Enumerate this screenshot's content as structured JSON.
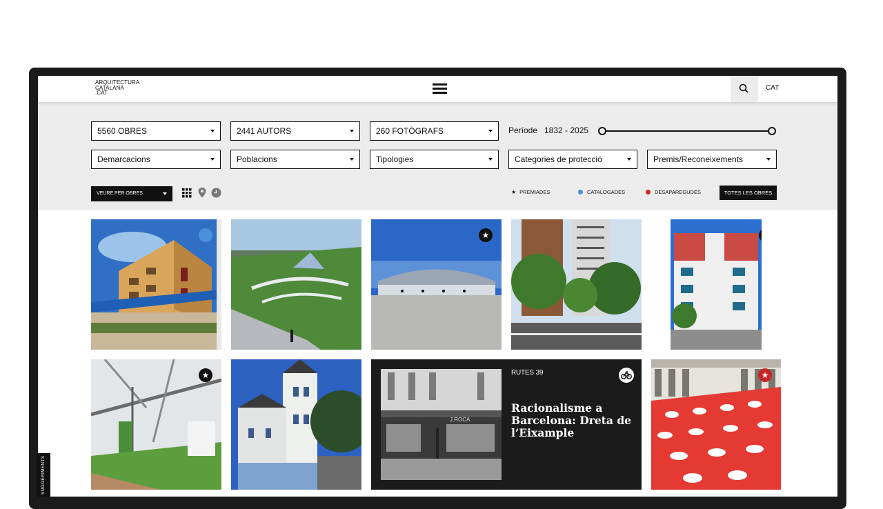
{
  "header": {
    "logo_lines": [
      "ARQUITECTURA",
      "CATALANA",
      ".CAT"
    ],
    "menu_icon": "hamburger-icon",
    "search_icon": "search-icon",
    "language": "CAT"
  },
  "filters": {
    "row1": [
      {
        "label": "5560 OBRES"
      },
      {
        "label": "2441 AUTORS"
      },
      {
        "label": "260 FOTÒGRAFS"
      }
    ],
    "period": {
      "label": "Període",
      "range": "1832 - 2025",
      "min": 1832,
      "max": 2025
    },
    "row2": [
      {
        "label": "Demarcacions"
      },
      {
        "label": "Poblacions"
      },
      {
        "label": "Tipologies"
      },
      {
        "label": "Categories de protecció"
      },
      {
        "label": "Premis/Reconeixements"
      }
    ]
  },
  "toolbar": {
    "view_select": "VEURE PER OBRES",
    "view_icons": [
      "grid-icon",
      "map-pin-icon",
      "clock-icon"
    ],
    "legend": [
      {
        "symbol": "★",
        "label": "PREMIADES"
      },
      {
        "color": "#4a90d9",
        "label": "CATALOGADES"
      },
      {
        "color": "#c62828",
        "label": "DESAPAREGUDES"
      }
    ],
    "all_button": "TOTES LES OBRES"
  },
  "colors": {
    "catalogued": "#4a90d9",
    "disappeared": "#c62828",
    "dark": "#111111",
    "panel": "#ececec"
  },
  "grid": {
    "works": [
      {
        "image": "yellow residential building with blue railing",
        "badge": "catalogued"
      },
      {
        "image": "landscaped park with green lawn and curved paths",
        "badge": ""
      },
      {
        "image": "steel arched pavilion under blue sky",
        "badge": "awarded"
      },
      {
        "image": "modern towers with trees and cyclists on street",
        "badge": ""
      },
      {
        "image": "red and white apartment block",
        "badge": "awarded"
      },
      {
        "image": "steel pergola structure over garden",
        "badge": "awarded"
      },
      {
        "image": "white historic building with tower",
        "badge": ""
      },
      {
        "image": "courtyard with red floor and white umbrellas",
        "badge": "awarded-red"
      }
    ],
    "route": {
      "tag": "RUTES 39",
      "title": "Racionalisme a Barcelona: Dreta de l’Eixample",
      "icon": "bicycle-icon",
      "image_sign": "J.ROCA"
    }
  },
  "side_tab": "SUGGERIMENTS"
}
